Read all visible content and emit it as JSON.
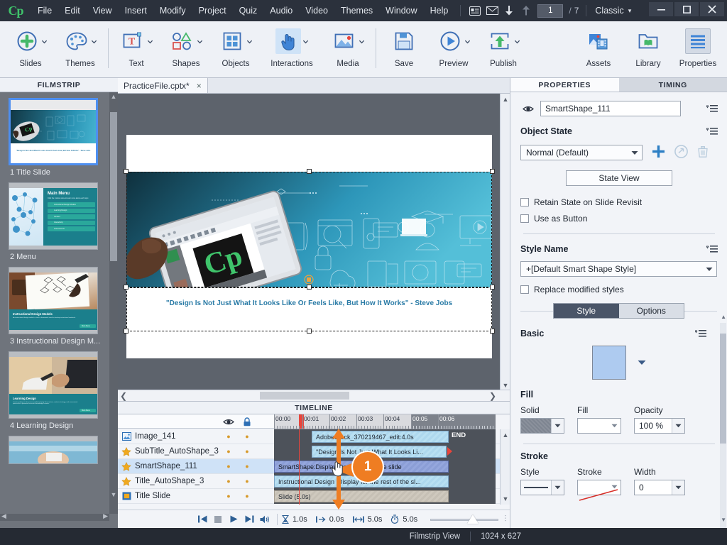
{
  "app": {
    "logo": "Cp",
    "menus": [
      "File",
      "Edit",
      "View",
      "Insert",
      "Modify",
      "Project",
      "Quiz",
      "Audio",
      "Video",
      "Themes",
      "Window",
      "Help"
    ],
    "nav": {
      "current_slide": "1",
      "separator": "/",
      "total_slides": "7",
      "icons": [
        "filmstrip-icon",
        "mail-icon",
        "down-arrow-icon",
        "up-arrow-icon"
      ]
    },
    "workspace": {
      "label": "Classic",
      "caret": "▾"
    },
    "window_controls": {
      "minimize": "—",
      "maximize": "❐",
      "close": "✕"
    }
  },
  "toolbar": {
    "groups": [
      {
        "items": [
          {
            "label": "Slides",
            "icon": "plus-circle-icon",
            "has_caret": true,
            "selected": false
          },
          {
            "label": "Themes",
            "icon": "palette-icon",
            "has_caret": true,
            "selected": false
          }
        ]
      },
      {
        "items": [
          {
            "label": "Text",
            "icon": "text-box-icon",
            "has_caret": true,
            "selected": false
          },
          {
            "label": "Shapes",
            "icon": "shapes-icon",
            "has_caret": true,
            "selected": false
          },
          {
            "label": "Objects",
            "icon": "objects-grid-icon",
            "has_caret": true,
            "selected": false
          },
          {
            "label": "Interactions",
            "icon": "hand-pointer-icon",
            "has_caret": true,
            "selected": false
          },
          {
            "label": "Media",
            "icon": "image-media-icon",
            "has_caret": true,
            "selected": false
          }
        ]
      },
      {
        "items": [
          {
            "label": "Save",
            "icon": "floppy-save-icon",
            "has_caret": false,
            "selected": false
          },
          {
            "label": "Preview",
            "icon": "play-preview-icon",
            "has_caret": true,
            "selected": false
          },
          {
            "label": "Publish",
            "icon": "publish-upload-icon",
            "has_caret": true,
            "selected": false
          }
        ]
      }
    ],
    "right_items": [
      {
        "label": "Assets",
        "icon": "assets-icon",
        "selected": false
      },
      {
        "label": "Library",
        "icon": "library-folder-icon",
        "selected": false
      },
      {
        "label": "Properties",
        "icon": "properties-lines-icon",
        "selected": true
      }
    ]
  },
  "filmstrip": {
    "title": "FILMSTRIP",
    "slides": [
      {
        "caption": "1 Title Slide",
        "active": true,
        "style": "title",
        "heading": "",
        "sub": "\"Design Is Not Just What It Looks Like Or Feels Like, But How It Works\" - Steve Jobs"
      },
      {
        "caption": "2 Menu",
        "active": false,
        "style": "menu",
        "heading": "Main Menu",
        "sub": "Click the module name to learn more about each topic.",
        "items": [
          "Instructional Design Models",
          "Learning Design",
          "Content",
          "Interactivity",
          "Assessments"
        ]
      },
      {
        "caption": "3 Instructional Design M...",
        "active": false,
        "style": "sketch",
        "heading": "Instructional Design Models",
        "sub": "An instructional design model is a tool or framework used to develop instructional materials.",
        "button": "Main Menu"
      },
      {
        "caption": "4 Learning Design",
        "active": false,
        "style": "photo",
        "heading": "Learning Design",
        "sub": "Learning design is the process of determining the structure, content, strategy, and assessment processes to promote successful knowledge transfer.",
        "button": "Main Menu"
      },
      {
        "caption": "",
        "active": false,
        "style": "bluephoto",
        "heading": "",
        "sub": ""
      }
    ]
  },
  "stage": {
    "tab": {
      "label": "PracticeFile.cptx*",
      "close": "×"
    },
    "slide_quote": "\"Design Is Not Just What It Looks Like Or Feels Like, But How It Works\" - Steve Jobs",
    "hero_logo": "Cp"
  },
  "timeline": {
    "title": "TIMELINE",
    "col_headers": {
      "eye": "eye-icon",
      "lock": "lock-icon"
    },
    "ruler_labels": [
      "00:00",
      "00:01",
      "00:02",
      "00:03",
      "00:04",
      "00:05",
      "00:06"
    ],
    "rows": [
      {
        "name": "Image_141",
        "icon": "image-icon",
        "bar_label": "AdobeStock_370219467_edit:4.0s",
        "selected": false,
        "type": "image",
        "start_pct": 17,
        "width_pct": 62,
        "end_label": "END"
      },
      {
        "name": "SubTitle_AutoShape_3",
        "icon": "star-icon",
        "bar_label": "\"Design Is Not Just What It Looks Li...",
        "selected": false,
        "type": "shape",
        "start_pct": 17,
        "width_pct": 62,
        "end_label": ""
      },
      {
        "name": "SmartShape_111",
        "icon": "star-icon",
        "bar_label": "SmartShape:Display for the rest of the slide",
        "selected": true,
        "type": "shape",
        "start_pct": 0,
        "width_pct": 79,
        "end_label": ""
      },
      {
        "name": "Title_AutoShape_3",
        "icon": "star-icon",
        "bar_label": "Instructional Design :Display for the rest of the sl...",
        "selected": false,
        "type": "shape",
        "start_pct": 0,
        "width_pct": 79,
        "end_label": ""
      },
      {
        "name": "Title Slide",
        "icon": "slide-icon",
        "bar_label": "Slide (5.0s)",
        "selected": false,
        "type": "slide",
        "start_pct": 0,
        "width_pct": 79,
        "end_label": ""
      }
    ],
    "footer": {
      "transport": [
        "skip-start-icon",
        "stop-icon",
        "play-icon",
        "skip-end-icon",
        "audio-icon"
      ],
      "fields": [
        {
          "icon": "hourglass-icon",
          "value": "1.0s"
        },
        {
          "icon": "start-bracket-icon",
          "value": "0.0s"
        },
        {
          "icon": "span-bracket-icon",
          "value": "5.0s"
        },
        {
          "icon": "stopwatch-icon",
          "value": "5.0s"
        }
      ],
      "grip": "⫶"
    },
    "callout": {
      "number": "1"
    }
  },
  "properties": {
    "tabs": [
      {
        "label": "PROPERTIES",
        "active": true
      },
      {
        "label": "TIMING",
        "active": false
      }
    ],
    "object_name": "SmartShape_111",
    "sections": {
      "object_state": {
        "title": "Object State",
        "state_value": "Normal (Default)",
        "state_view_button": "State View",
        "checkboxes": [
          {
            "label": "Retain State on Slide Revisit",
            "checked": false
          },
          {
            "label": "Use as Button",
            "checked": false
          }
        ],
        "actions": [
          "add-state-icon",
          "reset-state-icon",
          "delete-state-icon"
        ]
      },
      "style_name": {
        "title": "Style Name",
        "value": "+[Default Smart Shape Style]",
        "replace_checkbox": {
          "label": "Replace modified styles",
          "checked": false
        }
      },
      "segmented": {
        "options": [
          {
            "label": "Style",
            "active": true
          },
          {
            "label": "Options",
            "active": false
          }
        ]
      },
      "basic": {
        "title": "Basic",
        "swatch_color": "#aecbf0"
      },
      "fill": {
        "title": "Fill",
        "fields": [
          {
            "label": "Solid",
            "type": "color",
            "value": "#7e8591"
          },
          {
            "label": "Fill",
            "type": "select",
            "value": ""
          },
          {
            "label": "Opacity",
            "type": "text",
            "value": "100 %"
          }
        ]
      },
      "stroke": {
        "title": "Stroke",
        "fields": [
          {
            "label": "Style",
            "type": "line",
            "value": ""
          },
          {
            "label": "Stroke",
            "type": "color",
            "value": ""
          },
          {
            "label": "Width",
            "type": "text",
            "value": "0"
          }
        ]
      }
    }
  },
  "statusbar": {
    "view_mode": "Filmstrip View",
    "dimensions": "1024 x 627"
  },
  "colors": {
    "accent_blue": "#2d5f94",
    "callout_orange": "#ef7d22",
    "selected_row": "#cfe2f7",
    "dark_chrome": "#252a33",
    "panel_bg": "#f2f4f8"
  }
}
